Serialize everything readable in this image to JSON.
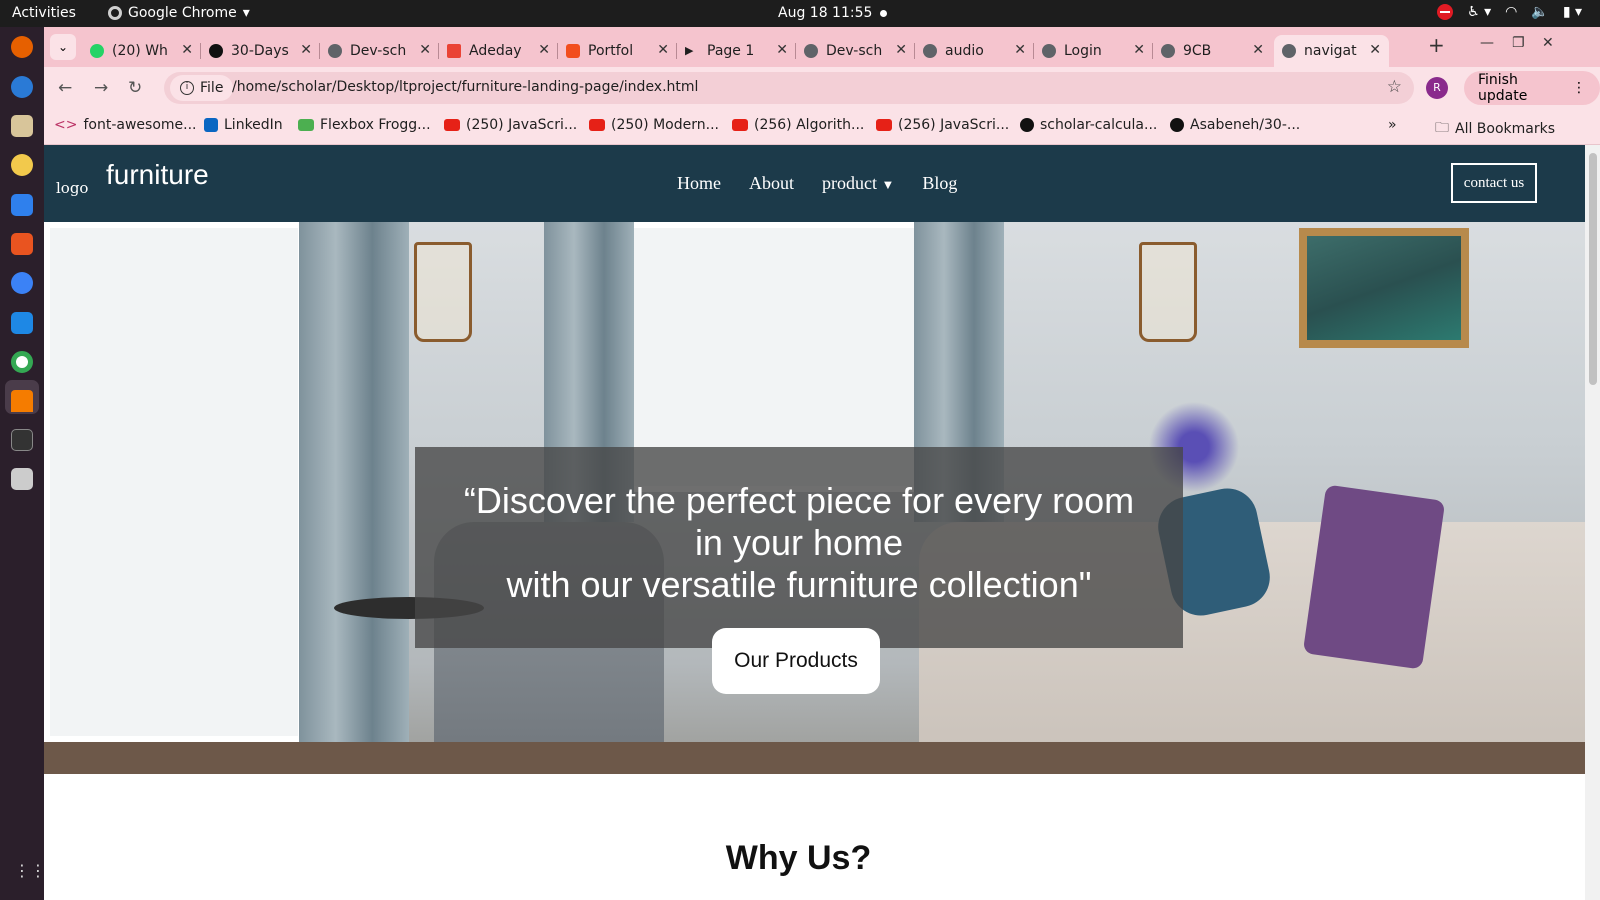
{
  "system": {
    "activities": "Activities",
    "app_name": "Google Chrome",
    "clock": "Aug 18  11:55"
  },
  "browser": {
    "tabs": [
      {
        "label": "(20) Wh",
        "icon": "whatsapp-icon"
      },
      {
        "label": "30-Days",
        "icon": "github-icon"
      },
      {
        "label": "Dev-sch",
        "icon": "globe-icon"
      },
      {
        "label": "Adeday",
        "icon": "gmail-icon"
      },
      {
        "label": "Portfol",
        "icon": "figma-icon"
      },
      {
        "label": "Page 1",
        "icon": "play-icon"
      },
      {
        "label": "Dev-sch",
        "icon": "globe-icon"
      },
      {
        "label": "audio",
        "icon": "globe-icon"
      },
      {
        "label": "Login",
        "icon": "globe-icon"
      },
      {
        "label": "9CB",
        "icon": "globe-icon"
      },
      {
        "label": "navigat",
        "icon": "globe-icon",
        "active": true
      }
    ],
    "omnibox": {
      "chip": "File",
      "url": "/home/scholar/Desktop/ltproject/furniture-landing-page/index.html"
    },
    "profile_initial": "R",
    "finish_update": "Finish update",
    "bookmarks": [
      "font-awesome...",
      "LinkedIn",
      "Flexbox Frogg...",
      "(250) JavaScri...",
      "(250) Modern...",
      "(256) Algorith...",
      "(256) JavaScri...",
      "scholar-calcula...",
      "Asabeneh/30-..."
    ],
    "all_bookmarks": "All Bookmarks"
  },
  "site": {
    "logo_alt": "logo",
    "brand": "furniture",
    "nav": [
      "Home",
      "About",
      "product",
      "Blog"
    ],
    "contact": "contact us",
    "hero_text": "“Discover the perfect piece for every room\nin your home\nwith our versatile furniture collection\"",
    "cta": "Our Products",
    "why_title": "Why Us?"
  },
  "colors": {
    "navbar_bg": "#1c3a4a",
    "tab_strip": "#f5c4ce",
    "toolbar": "#fbe2e7"
  }
}
